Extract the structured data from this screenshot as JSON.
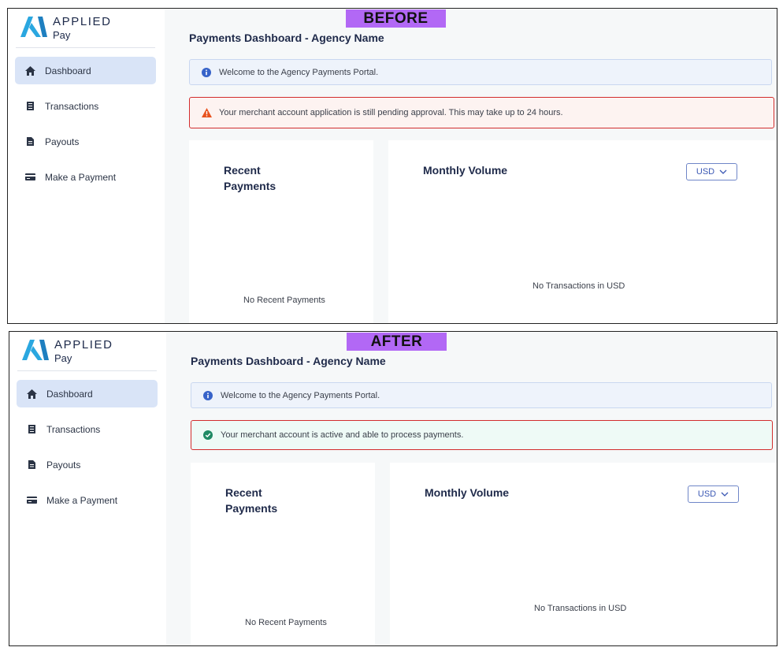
{
  "colors": {
    "accent": "#2aa7e0",
    "nav_active_bg": "#d9e4f7",
    "tag_bg": "#b268f5",
    "warning_icon": "#e8531f",
    "success_icon": "#1f8a64",
    "info_icon": "#3763c9",
    "highlight_border": "#d22d2d"
  },
  "before": {
    "tag": "BEFORE",
    "logo": {
      "brand": "APPLIED",
      "sub": "Pay"
    },
    "nav": [
      {
        "label": "Dashboard",
        "icon": "home-icon",
        "active": true
      },
      {
        "label": "Transactions",
        "icon": "receipt-icon",
        "active": false
      },
      {
        "label": "Payouts",
        "icon": "document-icon",
        "active": false
      },
      {
        "label": "Make a Payment",
        "icon": "credit-card-icon",
        "active": false
      }
    ],
    "title": "Payments Dashboard -  Agency Name",
    "info_alert": "Welcome to the Agency Payments Portal.",
    "status_alert": "Your merchant account application is still pending approval. This may take up to 24 hours.",
    "recent_payments": {
      "title_line1": "Recent",
      "title_line2": "Payments",
      "empty": "No Recent Payments"
    },
    "monthly_volume": {
      "title": "Monthly Volume",
      "currency": "USD",
      "empty": "No Transactions in USD"
    }
  },
  "after": {
    "tag": "AFTER",
    "logo": {
      "brand": "APPLIED",
      "sub": "Pay"
    },
    "nav": [
      {
        "label": "Dashboard",
        "icon": "home-icon",
        "active": true
      },
      {
        "label": "Transactions",
        "icon": "receipt-icon",
        "active": false
      },
      {
        "label": "Payouts",
        "icon": "document-icon",
        "active": false
      },
      {
        "label": "Make a Payment",
        "icon": "credit-card-icon",
        "active": false
      }
    ],
    "title": "Payments Dashboard -  Agency Name",
    "info_alert": "Welcome to the Agency Payments Portal.",
    "status_alert": "Your merchant account is active and able to process payments.",
    "recent_payments": {
      "title_line1": "Recent",
      "title_line2": "Payments",
      "empty": "No Recent Payments"
    },
    "monthly_volume": {
      "title": "Monthly Volume",
      "currency": "USD",
      "empty": "No Transactions in USD"
    }
  }
}
